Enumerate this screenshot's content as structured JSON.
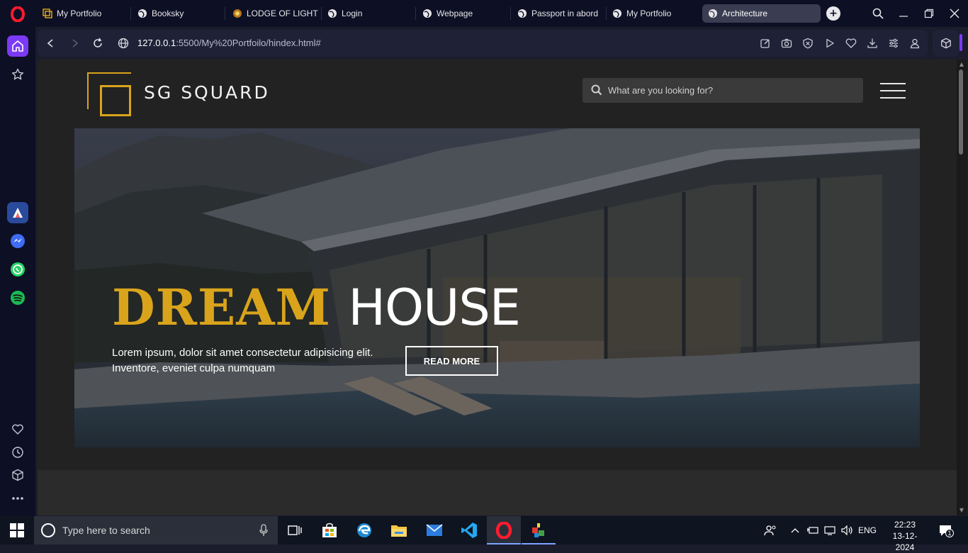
{
  "browser": {
    "tabs": [
      {
        "title": "My Portfolio",
        "icon": "sg-logo-icon",
        "active": false
      },
      {
        "title": "Booksky",
        "icon": "globe-icon",
        "active": false
      },
      {
        "title": "LODGE OF LIGHT N",
        "icon": "lodge-emblem-icon",
        "active": false
      },
      {
        "title": "Login",
        "icon": "globe-icon",
        "active": false
      },
      {
        "title": "Webpage",
        "icon": "globe-icon",
        "active": false
      },
      {
        "title": "Passport in abord",
        "icon": "globe-icon",
        "active": false
      },
      {
        "title": "My Portfolio",
        "icon": "globe-icon",
        "active": false
      },
      {
        "title": "Architecture",
        "icon": "globe-icon",
        "active": true
      }
    ],
    "url_host": "127.0.0.1",
    "url_rest": ":5500/My%20Portfoilo/hindex.html#",
    "accent_color": "#7b3af5"
  },
  "site": {
    "brand": "SG SQUARD",
    "search_placeholder": "What are you looking for?",
    "hero": {
      "title_word1": "DREAM",
      "title_word2": "HOUSE",
      "description": "Lorem ipsum, dolor sit amet consectetur adipisicing elit. Inventore, eveniet culpa numquam",
      "button_label": "READ MORE"
    },
    "accent_color": "#d9a41c"
  },
  "taskbar": {
    "search_placeholder": "Type here to search",
    "language": "ENG",
    "time": "22:23",
    "date": "13-12-2024",
    "notification_count": "1"
  }
}
